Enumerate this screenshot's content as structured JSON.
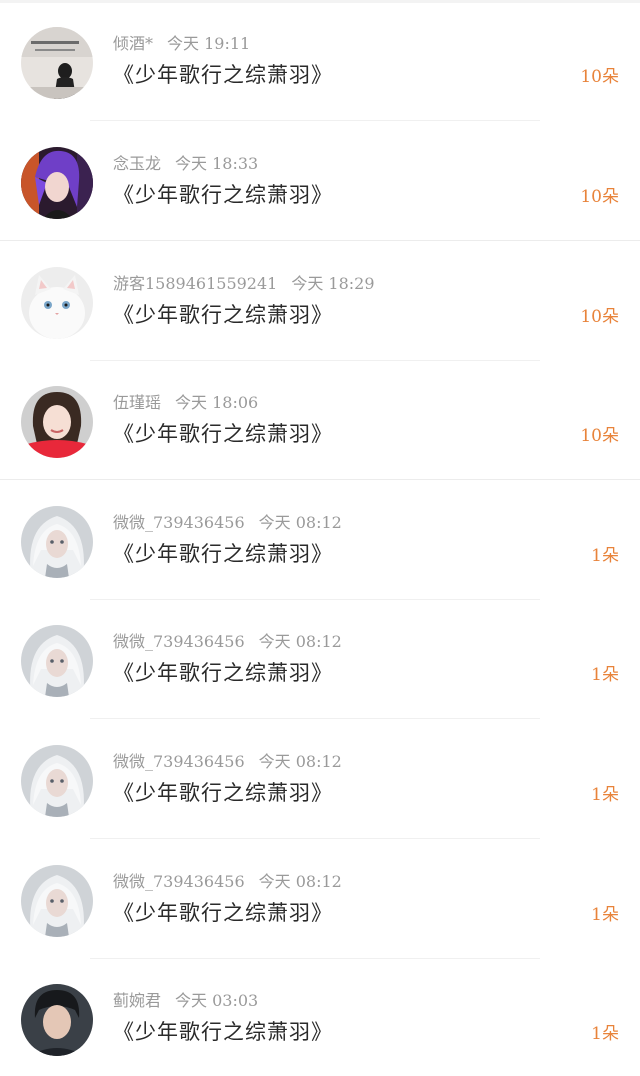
{
  "gifts": [
    {
      "user": "倾酒*",
      "time": "今天  19:11",
      "title": "《少年歌行之综萧羽》",
      "amount": "10朵",
      "avatar": "avatar-quote-card"
    },
    {
      "user": "念玉龙",
      "time": "今天  18:33",
      "title": "《少年歌行之综萧羽》",
      "amount": "10朵",
      "avatar": "avatar-purple-hair"
    },
    {
      "user": "游客1589461559241",
      "time": "今天  18:29",
      "title": "《少年歌行之综萧羽》",
      "amount": "10朵",
      "avatar": "avatar-white-cat"
    },
    {
      "user": "伍瑾瑶",
      "time": "今天  18:06",
      "title": "《少年歌行之综萧羽》",
      "amount": "10朵",
      "avatar": "avatar-girl-red"
    },
    {
      "user": "微微_739436456",
      "time": "今天  08:12",
      "title": "《少年歌行之综萧羽》",
      "amount": "1朵",
      "avatar": "avatar-white-hair-doll"
    },
    {
      "user": "微微_739436456",
      "time": "今天  08:12",
      "title": "《少年歌行之综萧羽》",
      "amount": "1朵",
      "avatar": "avatar-white-hair-doll"
    },
    {
      "user": "微微_739436456",
      "time": "今天  08:12",
      "title": "《少年歌行之综萧羽》",
      "amount": "1朵",
      "avatar": "avatar-white-hair-doll"
    },
    {
      "user": "微微_739436456",
      "time": "今天  08:12",
      "title": "《少年歌行之综萧羽》",
      "amount": "1朵",
      "avatar": "avatar-white-hair-doll"
    },
    {
      "user": "蓟婉君",
      "time": "今天  03:03",
      "title": "《少年歌行之综萧羽》",
      "amount": "1朵",
      "avatar": "avatar-boy-dark"
    }
  ],
  "colors": {
    "amount": "#e8833a",
    "meta": "#9a9a9a",
    "title": "#2a2a2a"
  }
}
